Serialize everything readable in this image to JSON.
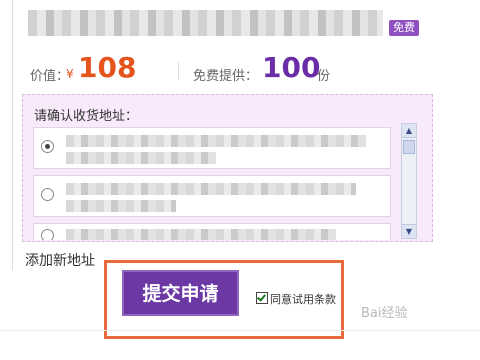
{
  "header": {
    "badge": "免费"
  },
  "pricing": {
    "value_label": "价值：",
    "currency": "¥",
    "price": "108",
    "supply_label": "免费提供：",
    "quantity": "100",
    "unit": "份"
  },
  "address_panel": {
    "title": "请确认收货地址："
  },
  "links": {
    "add_address": "添加新地址"
  },
  "actions": {
    "submit_label": "提交申请",
    "agree_label": "同意试用条款",
    "agree_checked": true
  },
  "watermark": {
    "text": "Bai经验"
  },
  "colors": {
    "price": "#e5541d",
    "quantity": "#6a2da7",
    "submit": "#6b38a4",
    "highlight": "#e8693a"
  }
}
